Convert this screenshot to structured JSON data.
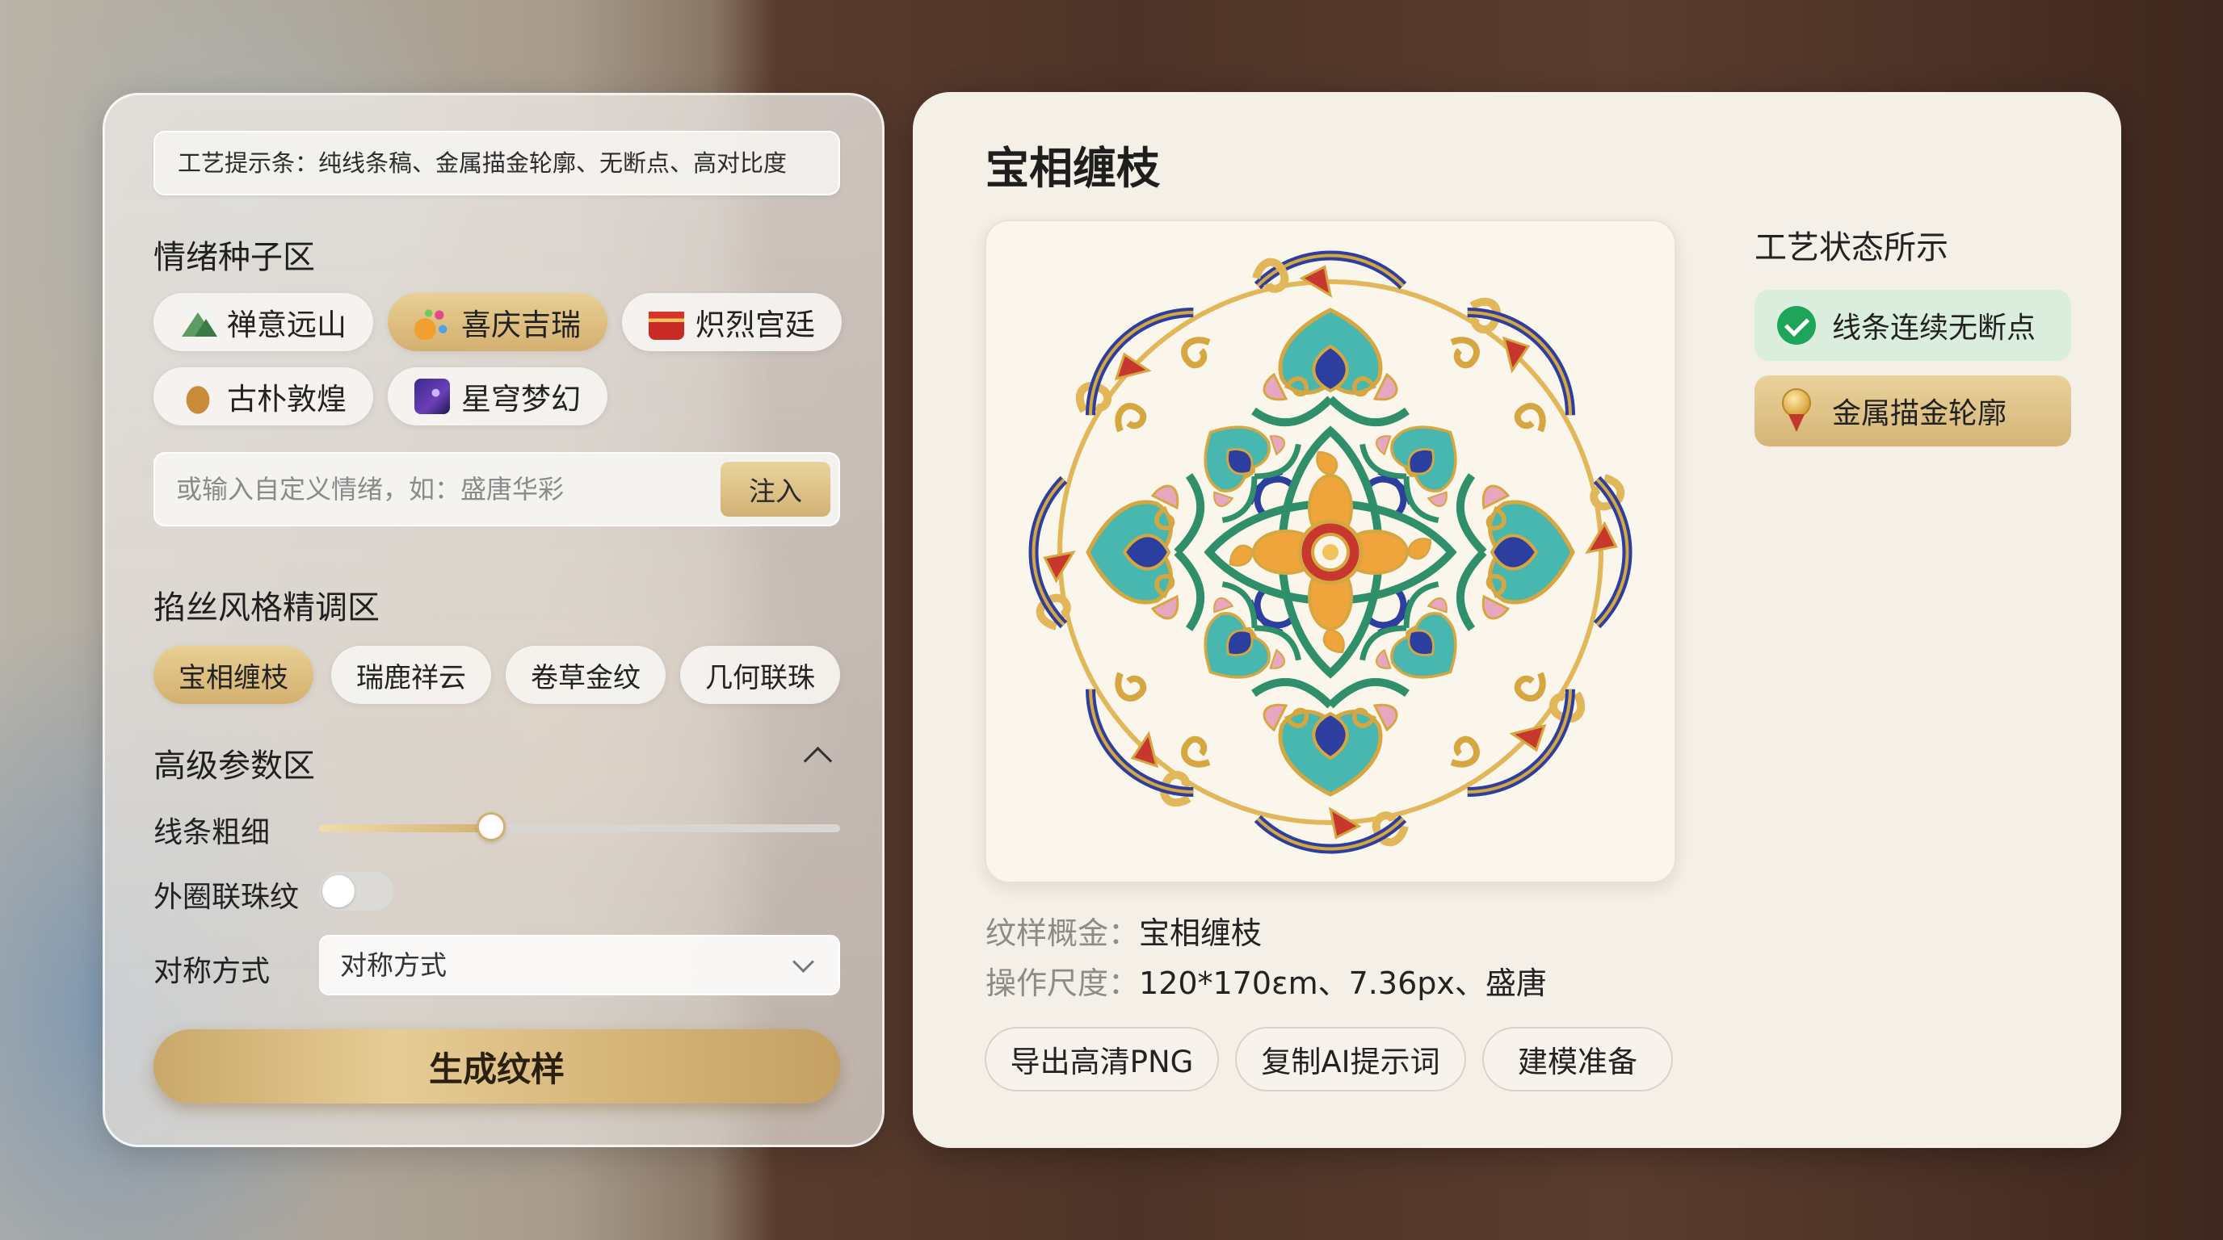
{
  "left": {
    "hint": "工艺提示条：纯线条稿、金属描金轮廓、无断点、高对比度",
    "emotion_title": "情绪种子区",
    "emotions": [
      {
        "label": "禅意远山",
        "icon": "mountain-icon",
        "active": false
      },
      {
        "label": "喜庆吉瑞",
        "icon": "party-popper-icon",
        "active": true
      },
      {
        "label": "炽烈宫廷",
        "icon": "palace-icon",
        "active": false
      },
      {
        "label": "古朴敦煌",
        "icon": "camel-icon",
        "active": false
      },
      {
        "label": "星穹梦幻",
        "icon": "starry-night-icon",
        "active": false
      }
    ],
    "custom_placeholder": "或输入自定义情绪，如：盛唐华彩",
    "inject_label": "注入",
    "style_title": "掐丝风格精调区",
    "styles": [
      {
        "label": "宝相缠枝",
        "active": true
      },
      {
        "label": "瑞鹿祥云",
        "active": false
      },
      {
        "label": "卷草金纹",
        "active": false
      },
      {
        "label": "几何联珠",
        "active": false
      }
    ],
    "advanced_title": "高级参数区",
    "line_weight_label": "线条粗细",
    "line_weight_value": 0.33,
    "outer_ring_label": "外圈联珠纹",
    "outer_ring_on": false,
    "symmetry_label": "对称方式",
    "symmetry_value": "对称方式",
    "generate_label": "生成纹样"
  },
  "right": {
    "title": "宝相缠枝",
    "status_title": "工艺状态所示",
    "status_items": [
      {
        "label": "线条连续无断点",
        "icon": "check-circle-icon"
      },
      {
        "label": "金属描金轮廓",
        "icon": "medal-icon"
      }
    ],
    "pattern_label": "纹样概金：",
    "pattern_value": "宝相缠枝",
    "size_label": "操作尺度：",
    "size_value": "120*170ɛm、7.36px、盛唐",
    "actions": [
      "导出高清PNG",
      "复制AI提示词",
      "建模准备"
    ]
  },
  "colors": {
    "gold": "#d4b070",
    "panel_bg": "#f4efe7",
    "success_green": "#1fa55a",
    "success_bg": "#dbeedd"
  }
}
